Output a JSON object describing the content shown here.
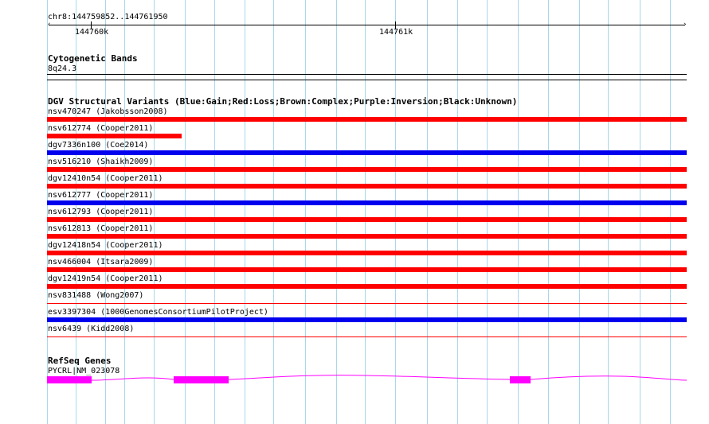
{
  "ruler": {
    "range_label": "chr8:144759852..144761950",
    "tick_labels": [
      "144760k",
      "144761k"
    ]
  },
  "cytoband": {
    "title": "Cytogenetic Bands",
    "band": "8q24.3"
  },
  "dgv": {
    "title": "DGV Structural Variants (Blue:Gain;Red:Loss;Brown:Complex;Purple:Inversion;Black:Unknown)",
    "colors": {
      "gain": "#0000ee",
      "loss": "#ff0000"
    },
    "variants": [
      {
        "label": "nsv470247 (Jakobsson2008)",
        "type": "loss",
        "extent": "full"
      },
      {
        "label": "nsv612774 (Cooper2011)",
        "type": "loss",
        "extent": "partial"
      },
      {
        "label": "dgv7336n100 (Coe2014)",
        "type": "gain",
        "extent": "full"
      },
      {
        "label": "nsv516210 (Shaikh2009)",
        "type": "loss",
        "extent": "full"
      },
      {
        "label": "dgv12410n54 (Cooper2011)",
        "type": "loss",
        "extent": "full"
      },
      {
        "label": "nsv612777 (Cooper2011)",
        "type": "gain",
        "extent": "full"
      },
      {
        "label": "nsv612793 (Cooper2011)",
        "type": "loss",
        "extent": "full"
      },
      {
        "label": "nsv612813 (Cooper2011)",
        "type": "loss",
        "extent": "full"
      },
      {
        "label": "dgv12418n54 (Cooper2011)",
        "type": "loss",
        "extent": "full"
      },
      {
        "label": "nsv466004 (Itsara2009)",
        "type": "loss",
        "extent": "full"
      },
      {
        "label": "dgv12419n54 (Cooper2011)",
        "type": "loss",
        "extent": "full"
      },
      {
        "label": "nsv831488 (Wong2007)",
        "type": "loss",
        "extent": "thin"
      },
      {
        "label": "esv3397304 (1000GenomesConsortiumPilotProject)",
        "type": "gain",
        "extent": "full"
      },
      {
        "label": "nsv6439 (Kidd2008)",
        "type": "loss",
        "extent": "thin"
      }
    ]
  },
  "refseq": {
    "title": "RefSeq Genes",
    "gene_label": "PYCRL|NM_023078",
    "color": "#ff00ff"
  }
}
